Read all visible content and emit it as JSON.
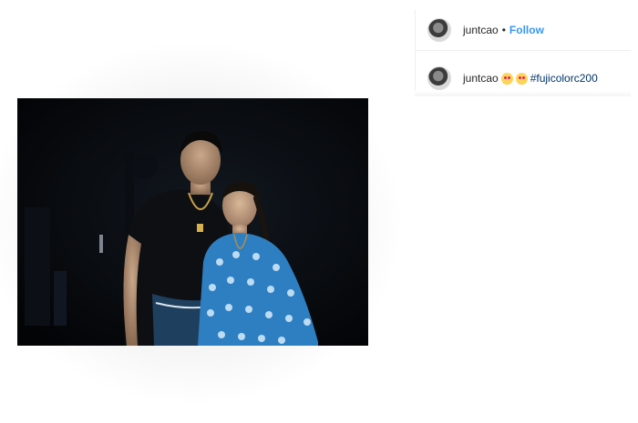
{
  "post": {
    "photo": {
      "alt_semantic": "photo"
    }
  },
  "header": {
    "username": "juntcao",
    "separator": "•",
    "follow_label": "Follow"
  },
  "caption": {
    "username": "juntcao",
    "emojis": [
      "heart-eyes-emoji",
      "heart-eyes-emoji"
    ],
    "hashtag": "#fujicolorc200"
  },
  "colors": {
    "follow": "#3897f0",
    "hashtag": "#003569",
    "text": "#262626",
    "divider": "#efefef"
  }
}
